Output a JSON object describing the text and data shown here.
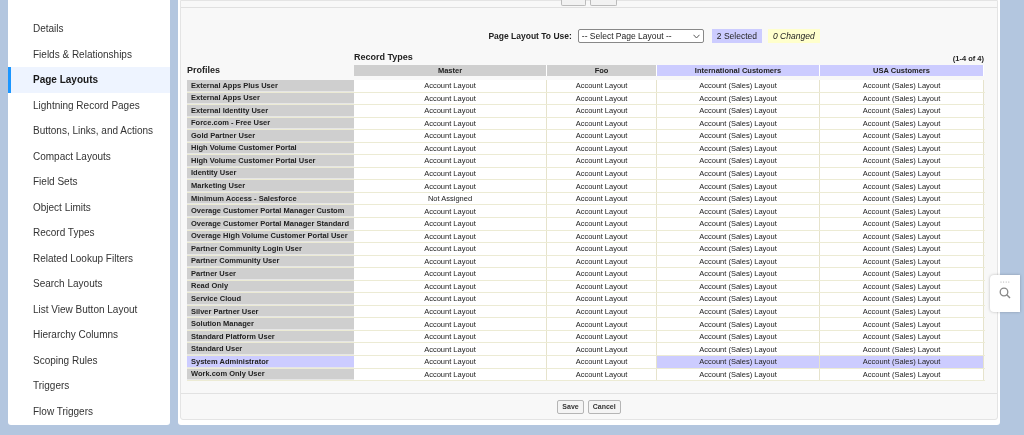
{
  "sidebar": {
    "items": [
      {
        "label": "Details",
        "selected": false
      },
      {
        "label": "Fields & Relationships",
        "selected": false
      },
      {
        "label": "Page Layouts",
        "selected": true
      },
      {
        "label": "Lightning Record Pages",
        "selected": false
      },
      {
        "label": "Buttons, Links, and Actions",
        "selected": false
      },
      {
        "label": "Compact Layouts",
        "selected": false
      },
      {
        "label": "Field Sets",
        "selected": false
      },
      {
        "label": "Object Limits",
        "selected": false
      },
      {
        "label": "Record Types",
        "selected": false
      },
      {
        "label": "Related Lookup Filters",
        "selected": false
      },
      {
        "label": "Search Layouts",
        "selected": false
      },
      {
        "label": "List View Button Layout",
        "selected": false
      },
      {
        "label": "Hierarchy Columns",
        "selected": false
      },
      {
        "label": "Scoping Rules",
        "selected": false
      },
      {
        "label": "Triggers",
        "selected": false
      },
      {
        "label": "Flow Triggers",
        "selected": false
      }
    ]
  },
  "toolbar": {
    "label": "Page Layout To Use:",
    "select": {
      "value": "-- Select Page Layout --"
    },
    "selected_count": "2 Selected",
    "changed_count": "0 Changed"
  },
  "table": {
    "record_types_label": "Record Types",
    "profiles_label": "Profiles",
    "range": "(1-4 of 4)",
    "columns": [
      {
        "label": "Master",
        "selected": false
      },
      {
        "label": "Foo",
        "selected": false
      },
      {
        "label": "International Customers",
        "selected": true
      },
      {
        "label": "USA Customers",
        "selected": true
      }
    ],
    "rows": [
      {
        "profile": "External Apps Plus User",
        "selected": false,
        "cells": [
          "Account Layout",
          "Account Layout",
          "Account (Sales) Layout",
          "Account (Sales) Layout"
        ]
      },
      {
        "profile": "External Apps User",
        "selected": false,
        "cells": [
          "Account Layout",
          "Account Layout",
          "Account (Sales) Layout",
          "Account (Sales) Layout"
        ]
      },
      {
        "profile": "External Identity User",
        "selected": false,
        "cells": [
          "Account Layout",
          "Account Layout",
          "Account (Sales) Layout",
          "Account (Sales) Layout"
        ]
      },
      {
        "profile": "Force.com - Free User",
        "selected": false,
        "cells": [
          "Account Layout",
          "Account Layout",
          "Account (Sales) Layout",
          "Account (Sales) Layout"
        ]
      },
      {
        "profile": "Gold Partner User",
        "selected": false,
        "cells": [
          "Account Layout",
          "Account Layout",
          "Account (Sales) Layout",
          "Account (Sales) Layout"
        ]
      },
      {
        "profile": "High Volume Customer Portal",
        "selected": false,
        "cells": [
          "Account Layout",
          "Account Layout",
          "Account (Sales) Layout",
          "Account (Sales) Layout"
        ]
      },
      {
        "profile": "High Volume Customer Portal User",
        "selected": false,
        "cells": [
          "Account Layout",
          "Account Layout",
          "Account (Sales) Layout",
          "Account (Sales) Layout"
        ]
      },
      {
        "profile": "Identity User",
        "selected": false,
        "cells": [
          "Account Layout",
          "Account Layout",
          "Account (Sales) Layout",
          "Account (Sales) Layout"
        ]
      },
      {
        "profile": "Marketing User",
        "selected": false,
        "cells": [
          "Account Layout",
          "Account Layout",
          "Account (Sales) Layout",
          "Account (Sales) Layout"
        ]
      },
      {
        "profile": "Minimum Access - Salesforce",
        "selected": false,
        "cells": [
          "Not Assigned",
          "Account Layout",
          "Account (Sales) Layout",
          "Account (Sales) Layout"
        ]
      },
      {
        "profile": "Overage Customer Portal Manager Custom",
        "selected": false,
        "cells": [
          "Account Layout",
          "Account Layout",
          "Account (Sales) Layout",
          "Account (Sales) Layout"
        ]
      },
      {
        "profile": "Overage Customer Portal Manager Standard",
        "selected": false,
        "cells": [
          "Account Layout",
          "Account Layout",
          "Account (Sales) Layout",
          "Account (Sales) Layout"
        ]
      },
      {
        "profile": "Overage High Volume Customer Portal User",
        "selected": false,
        "cells": [
          "Account Layout",
          "Account Layout",
          "Account (Sales) Layout",
          "Account (Sales) Layout"
        ]
      },
      {
        "profile": "Partner Community Login User",
        "selected": false,
        "cells": [
          "Account Layout",
          "Account Layout",
          "Account (Sales) Layout",
          "Account (Sales) Layout"
        ]
      },
      {
        "profile": "Partner Community User",
        "selected": false,
        "cells": [
          "Account Layout",
          "Account Layout",
          "Account (Sales) Layout",
          "Account (Sales) Layout"
        ]
      },
      {
        "profile": "Partner User",
        "selected": false,
        "cells": [
          "Account Layout",
          "Account Layout",
          "Account (Sales) Layout",
          "Account (Sales) Layout"
        ]
      },
      {
        "profile": "Read Only",
        "selected": false,
        "cells": [
          "Account Layout",
          "Account Layout",
          "Account (Sales) Layout",
          "Account (Sales) Layout"
        ]
      },
      {
        "profile": "Service Cloud",
        "selected": false,
        "cells": [
          "Account Layout",
          "Account Layout",
          "Account (Sales) Layout",
          "Account (Sales) Layout"
        ]
      },
      {
        "profile": "Silver Partner User",
        "selected": false,
        "cells": [
          "Account Layout",
          "Account Layout",
          "Account (Sales) Layout",
          "Account (Sales) Layout"
        ]
      },
      {
        "profile": "Solution Manager",
        "selected": false,
        "cells": [
          "Account Layout",
          "Account Layout",
          "Account (Sales) Layout",
          "Account (Sales) Layout"
        ]
      },
      {
        "profile": "Standard Platform User",
        "selected": false,
        "cells": [
          "Account Layout",
          "Account Layout",
          "Account (Sales) Layout",
          "Account (Sales) Layout"
        ]
      },
      {
        "profile": "Standard User",
        "selected": false,
        "cells": [
          "Account Layout",
          "Account Layout",
          "Account (Sales) Layout",
          "Account (Sales) Layout"
        ]
      },
      {
        "profile": "System Administrator",
        "selected": true,
        "cells": [
          "Account Layout",
          "Account Layout",
          "Account (Sales) Layout",
          "Account (Sales) Layout"
        ]
      },
      {
        "profile": "Work.com Only User",
        "selected": false,
        "cells": [
          "Account Layout",
          "Account Layout",
          "Account (Sales) Layout",
          "Account (Sales) Layout"
        ]
      }
    ]
  },
  "buttons": [
    {
      "label": "Save"
    },
    {
      "label": "Cancel"
    }
  ]
}
